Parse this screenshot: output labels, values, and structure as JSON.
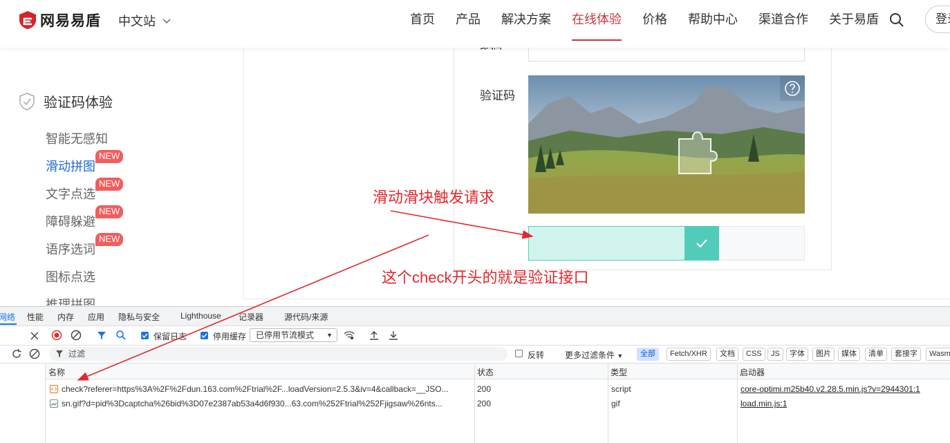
{
  "header": {
    "brand": "网易易盾",
    "site": "中文站",
    "nav": [
      "首页",
      "产品",
      "解决方案",
      "在线体验",
      "价格",
      "帮助中心",
      "渠道合作",
      "关于易盾"
    ],
    "login": "登录"
  },
  "sidebar": {
    "title": "验证码体验",
    "items": [
      {
        "label": "智能无感知",
        "badge": ""
      },
      {
        "label": "滑动拼图",
        "badge": "NEW"
      },
      {
        "label": "文字点选",
        "badge": "NEW"
      },
      {
        "label": "障碍躲避",
        "badge": "NEW"
      },
      {
        "label": "语序选词",
        "badge": "NEW"
      },
      {
        "label": "图标点选",
        "badge": ""
      },
      {
        "label": "推理拼图",
        "badge": ""
      }
    ]
  },
  "form": {
    "prev_label": "密码",
    "captcha_label": "验证码"
  },
  "annotations": {
    "slide": "滑动滑块触发请求",
    "check": "这个check开头的就是验证接口"
  },
  "devtools": {
    "tabs": [
      "网络",
      "性能",
      "内存",
      "应用",
      "隐私与安全",
      "Lighthouse",
      "记录器",
      "源代码/来源"
    ],
    "preserve_log": "保留日志",
    "disable_cache": "停用缓存",
    "throttle": "已停用节流模式",
    "filter_placeholder": "过滤",
    "invert": "反转",
    "more_filters": "更多过滤条件",
    "types": [
      "全部",
      "Fetch/XHR",
      "文档",
      "CSS",
      "JS",
      "字体",
      "图片",
      "媒体",
      "清单",
      "套接字",
      "Wasm"
    ],
    "columns": [
      "名称",
      "状态",
      "类型",
      "启动器"
    ],
    "rows": [
      {
        "name": "check?referer=https%3A%2F%2Fdun.163.com%2Ftrial%2F...loadVersion=2.5.3&iv=4&callback=__JSO...",
        "status": "200",
        "type": "script",
        "initiator": "core-optimi.m25b40.v2.28.5.min.js?v=2944301:1"
      },
      {
        "name": "sn.gif?d=pid%3Dcaptcha%26bid%3D07e2387ab53a4d6f930...63.com%252Ftrial%252Fjigsaw%26nts...",
        "status": "200",
        "type": "gif",
        "initiator": "load.min.js:1"
      }
    ]
  },
  "colors": {
    "accent_red": "#c8363a",
    "slider_green": "#52ccba",
    "annotation_red": "#e0292e",
    "devtools_blue": "#1a73e8"
  }
}
